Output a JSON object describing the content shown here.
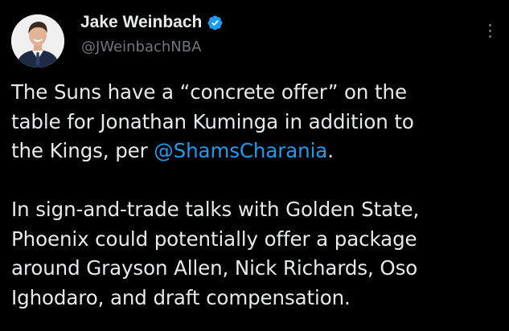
{
  "author": {
    "display_name": "Jake Weinbach",
    "handle": "@JWeinbachNBA",
    "verified": true
  },
  "tweet": {
    "paragraph1": {
      "line1": "The Suns have a “concrete offer” on the",
      "line2": "table for Jonathan Kuminga in addition to",
      "line3_prefix": "the Kings, per ",
      "line3_mention": "@ShamsCharania",
      "line3_suffix": "."
    },
    "paragraph2": {
      "line1": "In sign-and-trade talks with Golden State,",
      "line2": "Phoenix could potentially offer a package",
      "line3": "around Grayson Allen, Nick Richards, Oso",
      "line4": "Ighodaro, and draft compensation."
    }
  },
  "icons": {
    "verified": "verified-badge-icon",
    "more": "more-options-icon"
  },
  "colors": {
    "background": "#000000",
    "text_primary": "#e7e9ea",
    "text_secondary": "#71767b",
    "link": "#1d9bf0",
    "verified_badge": "#1d9bf0"
  }
}
